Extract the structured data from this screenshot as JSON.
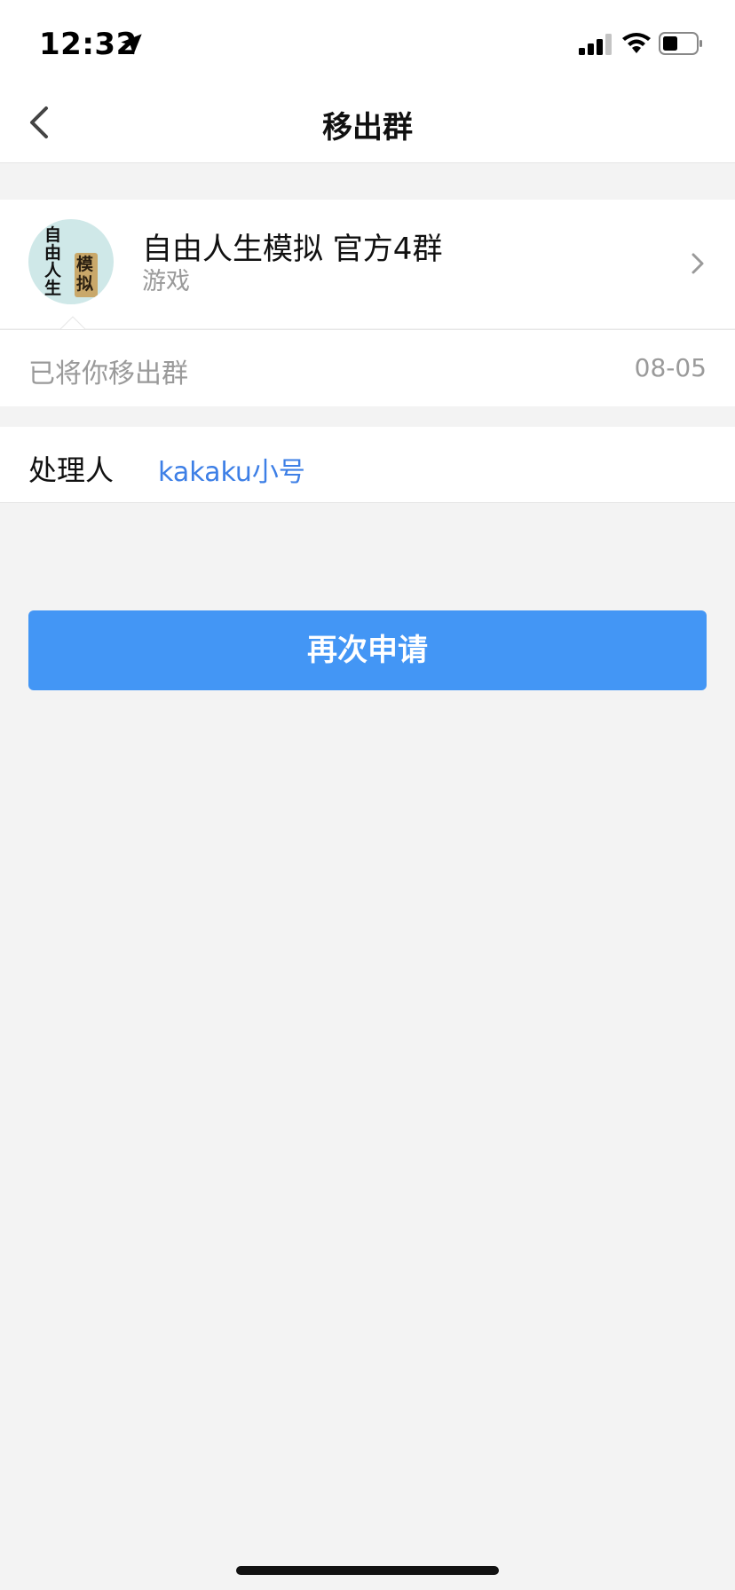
{
  "status_bar": {
    "time": "12:32",
    "icons": [
      "location-arrow-icon",
      "signal-icon",
      "wifi-icon",
      "battery-icon"
    ]
  },
  "nav": {
    "title": "移出群",
    "back_icon": "chevron-left-icon"
  },
  "group": {
    "name": "自由人生模拟 官方4群",
    "category": "游戏",
    "avatar_chars": "自由人生",
    "avatar_block_chars": "模拟",
    "chevron_icon": "chevron-right-icon"
  },
  "removal": {
    "message": "已将你移出群",
    "date": "08-05"
  },
  "handler": {
    "label": "处理人",
    "name": "kakaku小号"
  },
  "actions": {
    "reapply_label": "再次申请"
  },
  "colors": {
    "accent": "#4396f5",
    "link": "#3d7fe6",
    "background": "#f3f3f3",
    "muted_text": "#9a9a9a"
  }
}
